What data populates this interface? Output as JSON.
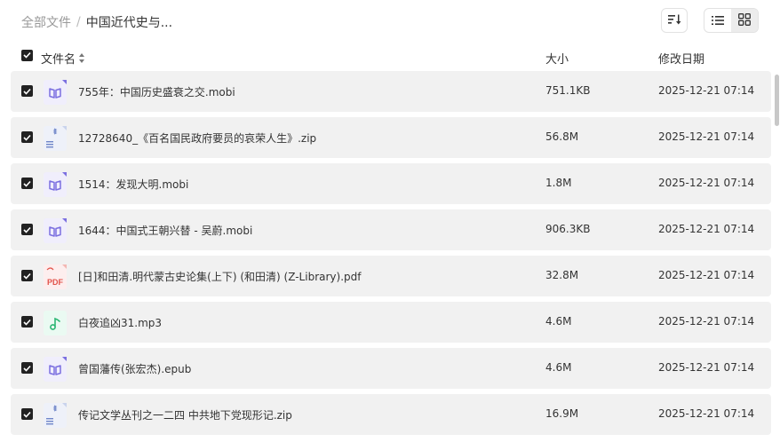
{
  "breadcrumb": {
    "root": "全部文件",
    "separator": "/",
    "current": "中国近代史与..."
  },
  "columns": {
    "name": "文件名",
    "size": "大小",
    "modified": "修改日期"
  },
  "files": [
    {
      "name": "755年：中国历史盛衰之交.mobi",
      "size": "751.1KB",
      "modified": "2025-12-21 07:14",
      "type": "ebook",
      "checked": true
    },
    {
      "name": "12728640_《百名国民政府要员的哀荣人生》.zip",
      "size": "56.8M",
      "modified": "2025-12-21 07:14",
      "type": "zip",
      "checked": true
    },
    {
      "name": "1514：发现大明.mobi",
      "size": "1.8M",
      "modified": "2025-12-21 07:14",
      "type": "ebook",
      "checked": true
    },
    {
      "name": "1644：中国式王朝兴替 - 吴蔚.mobi",
      "size": "906.3KB",
      "modified": "2025-12-21 07:14",
      "type": "ebook",
      "checked": true
    },
    {
      "name": "[日]和田清.明代蒙古史论集(上下) (和田清) (Z-Library).pdf",
      "size": "32.8M",
      "modified": "2025-12-21 07:14",
      "type": "pdf",
      "checked": true
    },
    {
      "name": "白夜追凶31.mp3",
      "size": "4.6M",
      "modified": "2025-12-21 07:14",
      "type": "audio",
      "checked": true
    },
    {
      "name": "曾国藩传(张宏杰).epub",
      "size": "4.6M",
      "modified": "2025-12-21 07:14",
      "type": "ebook",
      "checked": true
    },
    {
      "name": "传记文学丛刊之一二四 中共地下党现形记.zip",
      "size": "16.9M",
      "modified": "2025-12-21 07:14",
      "type": "zip",
      "checked": true
    }
  ],
  "icons": {
    "ebook": {
      "color": "#7b6fe0",
      "bg": "#f0eefc"
    },
    "zip": {
      "color": "#6f86c9",
      "bg": "#eef1f9"
    },
    "pdf": {
      "color": "#e2534a",
      "bg": "#fdeeee",
      "label": "PDF"
    },
    "audio": {
      "color": "#2bb673",
      "bg": "#eafaf2"
    }
  },
  "view_mode": "grid"
}
